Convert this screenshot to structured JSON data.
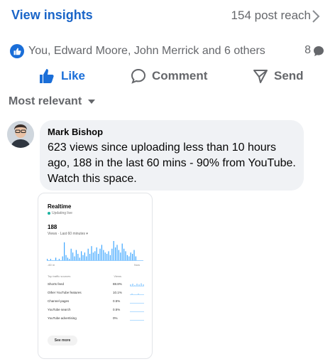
{
  "header": {
    "insights_label": "View insights",
    "reach_label": "154 post reach"
  },
  "reactions": {
    "summary": "You, Edward Moore, John Merrick and 6 others",
    "comment_count": "8"
  },
  "actions": {
    "like": "Like",
    "comment": "Comment",
    "send": "Send"
  },
  "sort": {
    "label": "Most relevant"
  },
  "comment": {
    "author": "Mark Bishop",
    "text": "623 views since uploading less than 10 hours ago, 188 in the last 60 mins - 90% from YouTube. Watch this space."
  },
  "attachment": {
    "title": "Realtime",
    "status": "Updating live",
    "views_number": "188",
    "views_label": "Views · Last 60 minutes",
    "axis_start": "-60 m",
    "axis_end": "Now",
    "traffic_header": "Top traffic sources",
    "views_header": "Views",
    "sources": [
      {
        "name": "Shorts feed",
        "pct": "88.8%"
      },
      {
        "name": "Other YouTube features",
        "pct": "10.1%"
      },
      {
        "name": "Channel pages",
        "pct": "0.5%"
      },
      {
        "name": "YouTube search",
        "pct": "0.5%"
      },
      {
        "name": "YouTube advertising",
        "pct": "0%"
      }
    ],
    "see_more": "See more"
  },
  "colors": {
    "accent": "#1a65c8",
    "like_blue": "#1a6ed8",
    "muted_text": "#65676b",
    "bubble_bg": "#f0f2f5"
  },
  "icons": [
    "chevron-right-icon",
    "thumbs-up-icon",
    "comment-icon",
    "send-icon",
    "chevron-down-icon",
    "comment-bubble-icon"
  ]
}
